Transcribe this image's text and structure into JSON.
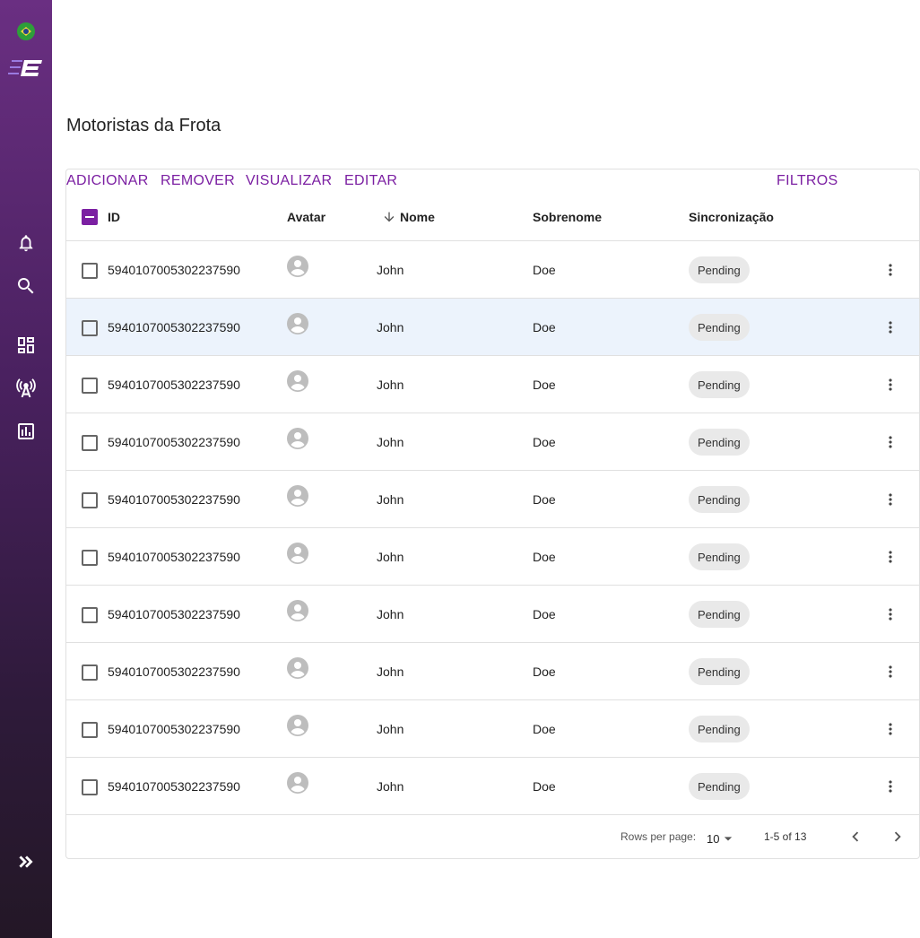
{
  "sidebar": {
    "items": [
      {
        "icon": "brazil-flag-icon"
      },
      {
        "icon": "app-logo-icon"
      },
      {
        "icon": "bell-icon"
      },
      {
        "icon": "search-icon"
      },
      {
        "icon": "dashboard-icon"
      },
      {
        "icon": "signal-tower-icon"
      },
      {
        "icon": "report-icon"
      },
      {
        "icon": "double-chevron-right-icon"
      }
    ],
    "colors": {
      "top": "#6a2f82",
      "bottom": "#231726"
    }
  },
  "page": {
    "title": "Motoristas da Frota"
  },
  "toolbar": {
    "add_label": "ADICIONAR",
    "remove_label": "REMOVER",
    "view_label": "VISUALIZAR",
    "edit_label": "EDITAR",
    "filters_label": "FILTROS",
    "accent": "#7b1fa2"
  },
  "table": {
    "headers": {
      "id": "ID",
      "avatar": "Avatar",
      "nome": "Nome",
      "sobrenome": "Sobrenome",
      "sync": "Sincronização"
    },
    "sort_column": "Nome",
    "sort_direction": "descending",
    "rows": [
      {
        "id": "5940107005302237590",
        "nome": "John",
        "sobrenome": "Doe",
        "sync": "Pending"
      },
      {
        "id": "5940107005302237590",
        "nome": "John",
        "sobrenome": "Doe",
        "sync": "Pending"
      },
      {
        "id": "5940107005302237590",
        "nome": "John",
        "sobrenome": "Doe",
        "sync": "Pending"
      },
      {
        "id": "5940107005302237590",
        "nome": "John",
        "sobrenome": "Doe",
        "sync": "Pending"
      },
      {
        "id": "5940107005302237590",
        "nome": "John",
        "sobrenome": "Doe",
        "sync": "Pending"
      },
      {
        "id": "5940107005302237590",
        "nome": "John",
        "sobrenome": "Doe",
        "sync": "Pending"
      },
      {
        "id": "5940107005302237590",
        "nome": "John",
        "sobrenome": "Doe",
        "sync": "Pending"
      },
      {
        "id": "5940107005302237590",
        "nome": "John",
        "sobrenome": "Doe",
        "sync": "Pending"
      },
      {
        "id": "5940107005302237590",
        "nome": "John",
        "sobrenome": "Doe",
        "sync": "Pending"
      },
      {
        "id": "5940107005302237590",
        "nome": "John",
        "sobrenome": "Doe",
        "sync": "Pending"
      }
    ],
    "highlighted_row": 1
  },
  "pagination": {
    "rows_per_page_label": "Rows per page:",
    "rows_per_page": "10",
    "range": "1-5 of 13"
  }
}
